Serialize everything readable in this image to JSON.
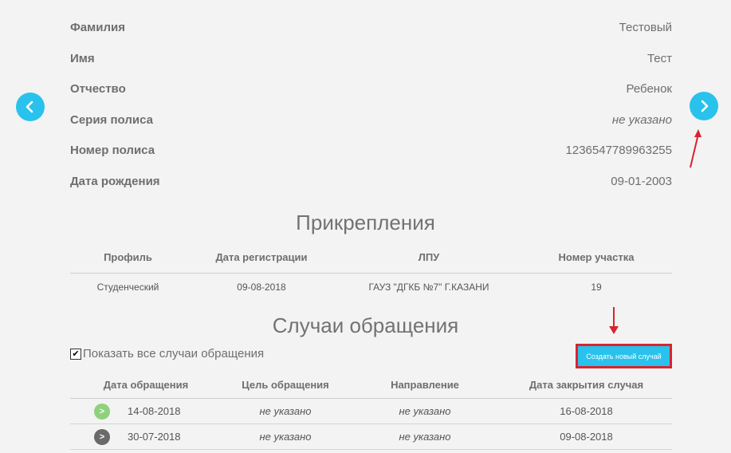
{
  "patient": {
    "rows": [
      {
        "label": "Фамилия",
        "value": "Тестовый",
        "italic": false
      },
      {
        "label": "Имя",
        "value": "Тест",
        "italic": false
      },
      {
        "label": "Отчество",
        "value": "Ребенок",
        "italic": false
      },
      {
        "label": "Серия полиса",
        "value": "не указано",
        "italic": true
      },
      {
        "label": "Номер полиса",
        "value": "1236547789963255",
        "italic": false
      },
      {
        "label": "Дата рождения",
        "value": "09-01-2003",
        "italic": false
      }
    ]
  },
  "attachments": {
    "title": "Прикрепления",
    "columns": [
      "Профиль",
      "Дата регистрации",
      "ЛПУ",
      "Номер участка"
    ],
    "rows": [
      [
        "Студенческий",
        "09-08-2018",
        "ГАУЗ \"ДГКБ №7\" Г.КАЗАНИ",
        "19"
      ]
    ]
  },
  "cases": {
    "title": "Случаи обращения",
    "show_all_label": "Показать все случаи обращения",
    "show_all_checked": true,
    "create_button_label": "Создать новый случай",
    "columns": [
      "Дата обращения",
      "Цель обращения",
      "Направление",
      "Дата закрытия случая"
    ],
    "rows": [
      {
        "status": "open",
        "date": "14-08-2018",
        "purpose": "не указано",
        "referral": "не указано",
        "closed": "16-08-2018"
      },
      {
        "status": "closed",
        "date": "30-07-2018",
        "purpose": "не указано",
        "referral": "не указано",
        "closed": "09-08-2018"
      }
    ]
  },
  "colors": {
    "accent": "#29c2ec",
    "highlight": "#d9232e",
    "status_open": "#8fd17c",
    "status_closed": "#6a6a6a"
  },
  "icons": {
    "prev": "chevron-left-icon",
    "next": "chevron-right-icon"
  }
}
